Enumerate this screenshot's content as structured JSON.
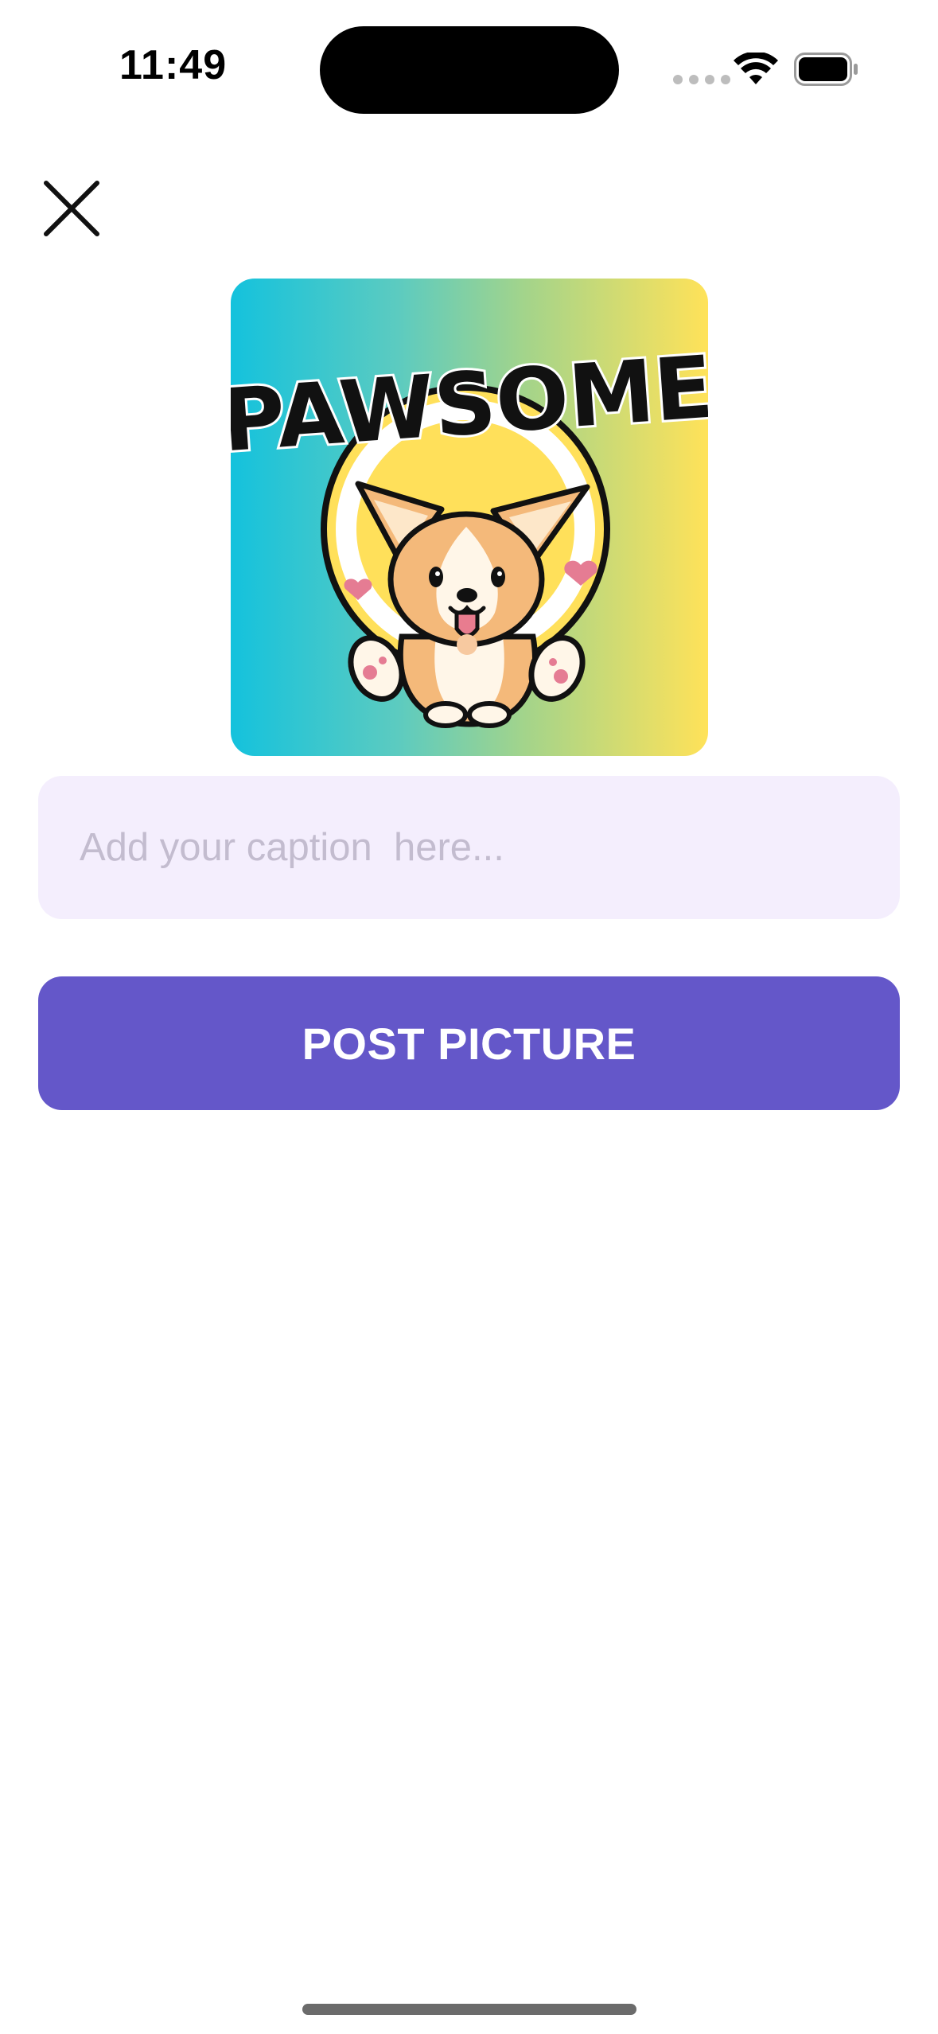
{
  "status_bar": {
    "time": "11:49",
    "icons": [
      "signal-dots-icon",
      "wifi-icon",
      "battery-icon"
    ]
  },
  "header": {
    "close_icon": "close-icon"
  },
  "picture": {
    "logo_text": "PAWSOME",
    "description_icon": "corgi-illustration"
  },
  "caption": {
    "placeholder": "Add your caption  here...",
    "value": ""
  },
  "post_button": {
    "label": "POST PICTURE"
  },
  "colors": {
    "accent": "#6457c9",
    "input_background": "#f4eefd",
    "placeholder": "#c3bccf",
    "gradient_start": "#14c2dd",
    "gradient_end": "#ffe259"
  }
}
